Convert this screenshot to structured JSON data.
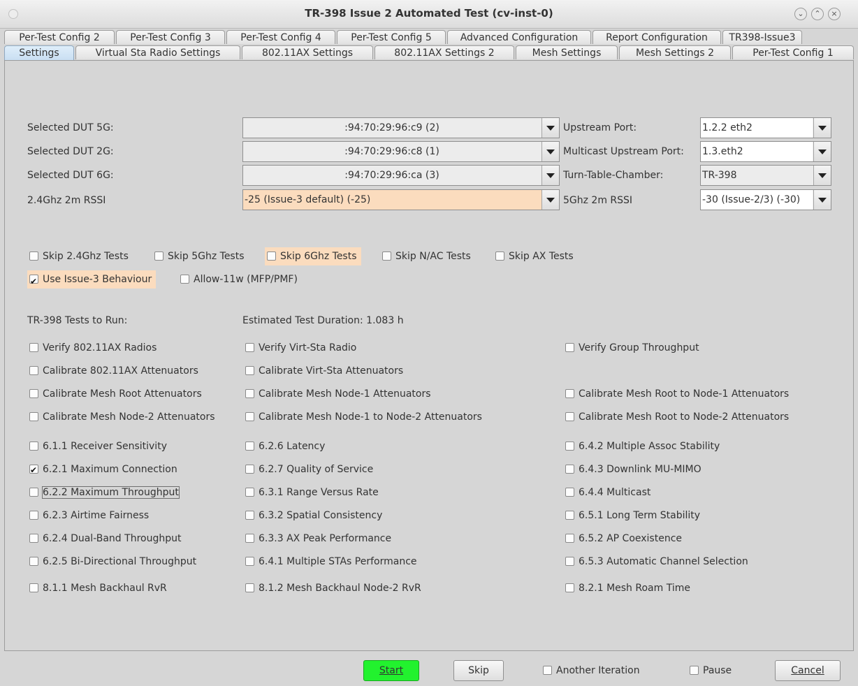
{
  "window": {
    "title": "TR-398 Issue 2 Automated Test  (cv-inst-0)",
    "controls": {
      "minimize": "⌄",
      "maximize": "⌃",
      "close": "×"
    }
  },
  "tabs_row1": [
    "Per-Test Config 2",
    "Per-Test Config 3",
    "Per-Test Config 4",
    "Per-Test Config 5",
    "Advanced Configuration",
    "Report Configuration",
    "TR398-Issue3"
  ],
  "tabs_row2": [
    "Settings",
    "Virtual Sta Radio Settings",
    "802.11AX Settings",
    "802.11AX Settings 2",
    "Mesh Settings",
    "Mesh Settings 2",
    "Per-Test Config 1"
  ],
  "active_tab": "Settings",
  "settings": {
    "dut5g": {
      "label": "Selected DUT 5G:",
      "value": ":94:70:29:96:c9 (2)"
    },
    "dut2g": {
      "label": "Selected DUT 2G:",
      "value": ":94:70:29:96:c8 (1)"
    },
    "dut6g": {
      "label": "Selected DUT 6G:",
      "value": ":94:70:29:96:ca (3)"
    },
    "rssi24": {
      "label": "2.4Ghz 2m RSSI",
      "value": "-25 (Issue-3 default) (-25)"
    },
    "upstream": {
      "label": "Upstream Port:",
      "value": "1.2.2 eth2"
    },
    "mcast_upstream": {
      "label": "Multicast Upstream Port:",
      "value": "1.3.eth2"
    },
    "turntable": {
      "label": "Turn-Table-Chamber:",
      "value": "TR-398"
    },
    "rssi5": {
      "label": "5Ghz 2m RSSI",
      "value": "-30 (Issue-2/3) (-30)"
    }
  },
  "skip_options": [
    {
      "label": "Skip 2.4Ghz Tests",
      "checked": false
    },
    {
      "label": "Skip 5Ghz Tests",
      "checked": false
    },
    {
      "label": "Skip 6Ghz Tests",
      "checked": false
    },
    {
      "label": "Skip N/AC Tests",
      "checked": false
    },
    {
      "label": "Skip AX Tests",
      "checked": false
    }
  ],
  "behaviour_options": [
    {
      "label": "Use Issue-3 Behaviour",
      "checked": true
    },
    {
      "label": "Allow-11w (MFP/PMF)",
      "checked": false
    }
  ],
  "tests_header": "TR-398 Tests to Run:",
  "estimated_duration": "Estimated Test Duration: 1.083 h",
  "tests": {
    "col1": [
      {
        "label": "Verify 802.11AX Radios",
        "checked": false
      },
      {
        "label": "Calibrate 802.11AX Attenuators",
        "checked": false
      },
      {
        "label": "Calibrate Mesh Root Attenuators",
        "checked": false
      },
      {
        "label": "Calibrate Mesh Node-2 Attenuators",
        "checked": false
      },
      {
        "label": "6.1.1 Receiver Sensitivity",
        "checked": false
      },
      {
        "label": "6.2.1 Maximum Connection",
        "checked": true
      },
      {
        "label": "6.2.2 Maximum Throughput",
        "checked": false
      },
      {
        "label": "6.2.3 Airtime Fairness",
        "checked": false
      },
      {
        "label": "6.2.4 Dual-Band Throughput",
        "checked": false
      },
      {
        "label": "6.2.5 Bi-Directional Throughput",
        "checked": false
      },
      {
        "label": "8.1.1 Mesh Backhaul RvR",
        "checked": false
      }
    ],
    "col2": [
      {
        "label": "Verify Virt-Sta Radio",
        "checked": false
      },
      {
        "label": "Calibrate Virt-Sta Attenuators",
        "checked": false
      },
      {
        "label": "Calibrate Mesh Node-1 Attenuators",
        "checked": false
      },
      {
        "label": "Calibrate Mesh Node-1 to Node-2 Attenuators",
        "checked": false
      },
      {
        "label": "6.2.6 Latency",
        "checked": false
      },
      {
        "label": "6.2.7 Quality of Service",
        "checked": false
      },
      {
        "label": "6.3.1 Range Versus Rate",
        "checked": false
      },
      {
        "label": "6.3.2 Spatial Consistency",
        "checked": false
      },
      {
        "label": "6.3.3 AX Peak Performance",
        "checked": false
      },
      {
        "label": "6.4.1 Multiple STAs Performance",
        "checked": false
      },
      {
        "label": "8.1.2 Mesh Backhaul Node-2 RvR",
        "checked": false
      }
    ],
    "col3": [
      {
        "label": "Verify Group Throughput",
        "checked": false
      },
      null,
      {
        "label": "Calibrate Mesh Root to Node-1 Attenuators",
        "checked": false
      },
      {
        "label": "Calibrate Mesh Root to Node-2 Attenuators",
        "checked": false
      },
      {
        "label": "6.4.2 Multiple Assoc Stability",
        "checked": false
      },
      {
        "label": "6.4.3 Downlink MU-MIMO",
        "checked": false
      },
      {
        "label": "6.4.4 Multicast",
        "checked": false
      },
      {
        "label": "6.5.1 Long Term Stability",
        "checked": false
      },
      {
        "label": "6.5.2 AP Coexistence",
        "checked": false
      },
      {
        "label": "6.5.3 Automatic Channel Selection",
        "checked": false
      },
      {
        "label": "8.2.1 Mesh Roam Time",
        "checked": false
      }
    ]
  },
  "bottom": {
    "start": "Start",
    "skip": "Skip",
    "another_iteration": {
      "label": "Another Iteration",
      "checked": false
    },
    "pause": {
      "label": "Pause",
      "checked": false
    },
    "cancel": "Cancel"
  },
  "colors": {
    "highlight": "#fbdcbe",
    "start_button": "#22f22e",
    "active_tab": "#c8def2"
  }
}
